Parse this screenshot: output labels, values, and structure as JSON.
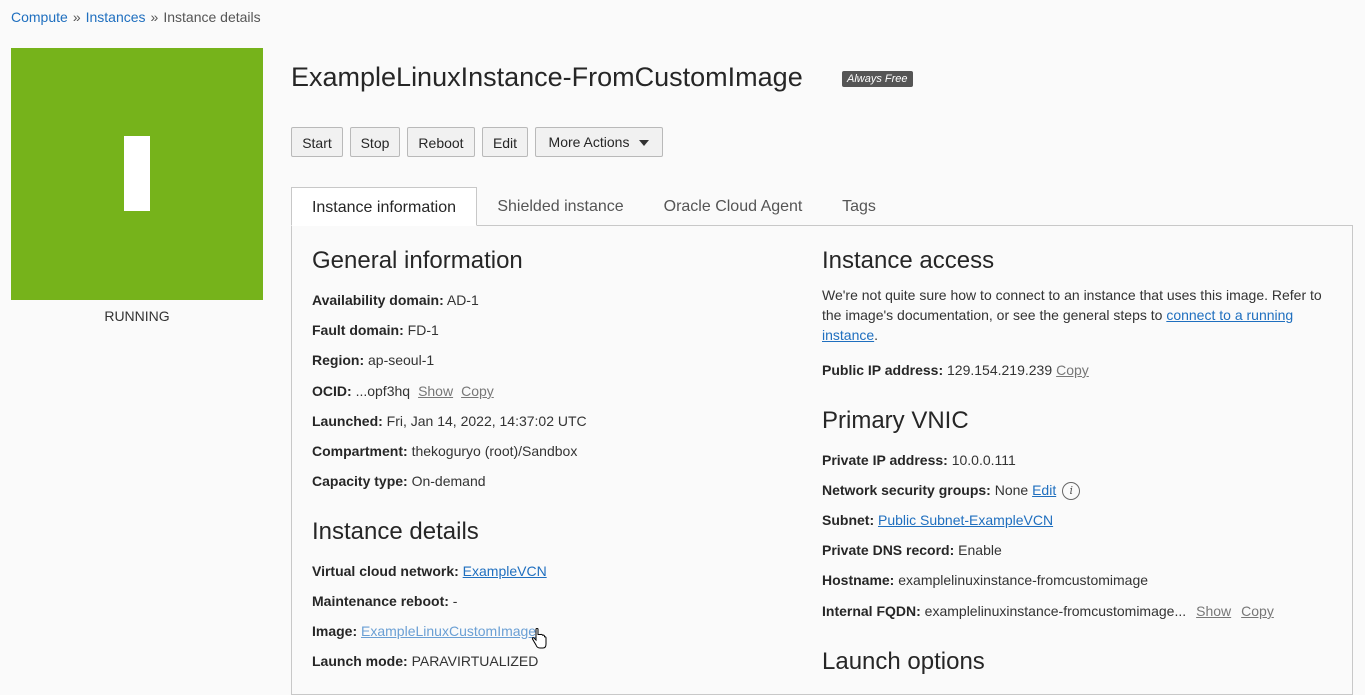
{
  "breadcrumb": {
    "items": [
      "Compute",
      "Instances"
    ],
    "current": "Instance details",
    "separator": "»"
  },
  "status": {
    "letter": "I",
    "label": "RUNNING",
    "color": "#76b31b"
  },
  "header": {
    "title": "ExampleLinuxInstance-FromCustomImage",
    "badge": "Always Free"
  },
  "actions": {
    "start": "Start",
    "stop": "Stop",
    "reboot": "Reboot",
    "edit": "Edit",
    "more": "More Actions"
  },
  "tabs": [
    "Instance information",
    "Shielded instance",
    "Oracle Cloud Agent",
    "Tags"
  ],
  "general": {
    "heading": "General information",
    "availability_label": "Availability domain:",
    "availability_value": "AD-1",
    "fault_label": "Fault domain:",
    "fault_value": "FD-1",
    "region_label": "Region:",
    "region_value": "ap-seoul-1",
    "ocid_label": "OCID:",
    "ocid_value": "...opf3hq",
    "show": "Show",
    "copy": "Copy",
    "launched_label": "Launched:",
    "launched_value": "Fri, Jan 14, 2022, 14:37:02 UTC",
    "compartment_label": "Compartment:",
    "compartment_value": "thekoguryo (root)/Sandbox",
    "capacity_label": "Capacity type:",
    "capacity_value": "On-demand"
  },
  "details": {
    "heading": "Instance details",
    "vcn_label": "Virtual cloud network:",
    "vcn_value": "ExampleVCN",
    "maint_label": "Maintenance reboot:",
    "maint_value": "-",
    "image_label": "Image:",
    "image_value": "ExampleLinuxCustomImage",
    "launch_label": "Launch mode:",
    "launch_value": "PARAVIRTUALIZED"
  },
  "access": {
    "heading": "Instance access",
    "text1": "We're not quite sure how to connect to an instance that uses this image. Refer to",
    "text2": "the image's documentation, or see the general steps to ",
    "link1": "connect to a running",
    "link2": "instance",
    "text3": ".",
    "ip_label": "Public IP address:",
    "ip_value": "129.154.219.239",
    "copy": "Copy"
  },
  "vnic": {
    "heading": "Primary VNIC",
    "private_ip_label": "Private IP address:",
    "private_ip_value": "10.0.0.111",
    "nsg_label": "Network security groups:",
    "nsg_value": "None",
    "nsg_edit": "Edit",
    "info_glyph": "i",
    "subnet_label": "Subnet:",
    "subnet_value": "Public Subnet-ExampleVCN",
    "dns_label": "Private DNS record:",
    "dns_value": "Enable",
    "hostname_label": "Hostname:",
    "hostname_value": "examplelinuxinstance-fromcustomimage",
    "fqdn_label": "Internal FQDN:",
    "fqdn_value": "examplelinuxinstance-fromcustomimage...",
    "show": "Show",
    "copy": "Copy"
  },
  "launch_options": {
    "heading": "Launch options"
  }
}
